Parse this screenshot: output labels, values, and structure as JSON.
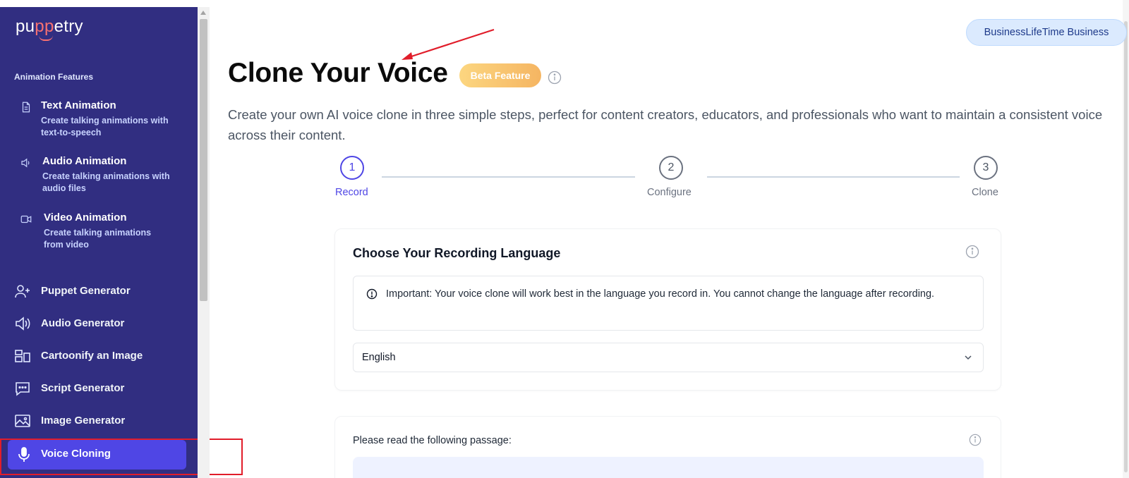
{
  "sidebar": {
    "logo": {
      "pre": "pu",
      "pp": "pp",
      "post": "etry"
    },
    "section_label": "Animation Features",
    "features": [
      {
        "title": "Text Animation",
        "desc": "Create talking animations with text-to-speech",
        "icon": "document-icon"
      },
      {
        "title": "Audio Animation",
        "desc": "Create talking animations with audio files",
        "icon": "speaker-icon"
      },
      {
        "title": "Video Animation",
        "desc": "Create talking animations from video",
        "icon": "video-camera-icon"
      }
    ],
    "nav": [
      {
        "label": "Puppet Generator",
        "icon": "user-plus-icon"
      },
      {
        "label": "Audio Generator",
        "icon": "speaker-icon"
      },
      {
        "label": "Cartoonify an Image",
        "icon": "layout-icon"
      },
      {
        "label": "Script Generator",
        "icon": "chat-bubble-icon"
      },
      {
        "label": "Image Generator",
        "icon": "image-icon"
      },
      {
        "label": "Voice Cloning",
        "icon": "microphone-icon",
        "active": true
      }
    ]
  },
  "header": {
    "account_label": "BusinessLifeTime Business"
  },
  "main": {
    "title": "Clone Your Voice",
    "badge": "Beta Feature",
    "subtitle": "Create your own AI voice clone in three simple steps, perfect for content creators, educators, and professionals who want to maintain a consistent voice across their content.",
    "steps": [
      {
        "number": "1",
        "label": "Record",
        "active": true
      },
      {
        "number": "2",
        "label": "Configure",
        "active": false
      },
      {
        "number": "3",
        "label": "Clone",
        "active": false
      }
    ],
    "language_card": {
      "title": "Choose Your Recording Language",
      "notice": "Important: Your voice clone will work best in the language you record in. You cannot change the language after recording.",
      "selected_language": "English"
    },
    "passage_card": {
      "label": "Please read the following passage:"
    }
  },
  "colors": {
    "sidebar_bg": "#312e81",
    "accent": "#4f46e5",
    "annotation_red": "#e11d2a",
    "badge_gradient_start": "#fcd680",
    "badge_gradient_end": "#f5b562"
  }
}
